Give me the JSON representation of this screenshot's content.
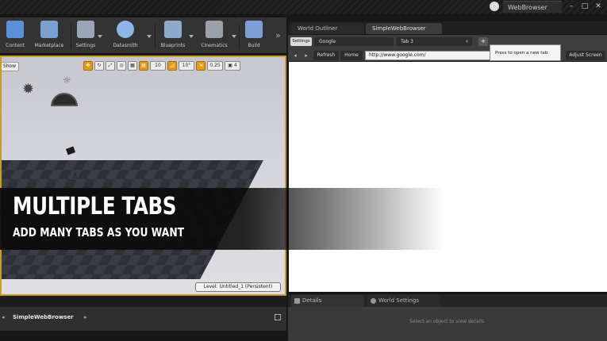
{
  "titlebar": {
    "app_title": "WebBrowser",
    "minimize": "–",
    "maximize": "□",
    "close": "✕"
  },
  "toolbar": {
    "buttons": [
      {
        "label": "Content",
        "icon": "grid-icon",
        "color": "#5b8fd8"
      },
      {
        "label": "Marketplace",
        "icon": "marketplace-icon",
        "color": "#7aa0cf"
      },
      {
        "label": "Settings",
        "icon": "gear-icon",
        "color": "#9aa6b8"
      },
      {
        "label": "Datasmith",
        "icon": "datasmith-icon",
        "color": "#8fb6e8"
      },
      {
        "label": "Blueprints",
        "icon": "blueprint-icon",
        "color": "#8fa9c8"
      },
      {
        "label": "Cinematics",
        "icon": "clapper-icon",
        "color": "#9aa0aa"
      },
      {
        "label": "Build",
        "icon": "build-icon",
        "color": "#7d9fd6"
      }
    ],
    "more": "»"
  },
  "viewport": {
    "show_label": "Show",
    "tools": [
      "✥",
      "↻",
      "⤢",
      "◎",
      "▦",
      "▤",
      "10",
      "◿",
      "10°",
      "⇲",
      "0.25",
      "▣ 4"
    ],
    "level_label": "Level: Untitled_1 (Persistent)"
  },
  "right_tabs": {
    "world_outliner": "World Outliner",
    "simple_web_browser": "SimpleWebBrowser"
  },
  "browser": {
    "settings_label": "Settings",
    "tabs": [
      {
        "label": "Google"
      },
      {
        "label": "Tab 3"
      }
    ],
    "tab_close": "×",
    "new_tab": "+",
    "tooltip": "Press to open a new tab",
    "back": "◂",
    "forward": "▸",
    "refresh_label": "Refresh",
    "home_label": "Home",
    "url": "http://www.google.com/",
    "adjust_label": "Adjust Screen"
  },
  "details": {
    "details_tab": "Details",
    "world_settings_tab": "World Settings",
    "hint": "Select an object to view details."
  },
  "content_browser": {
    "path_item": "SimpleWebBrowser",
    "left_arrow": "◂",
    "right_arrow": "▸"
  },
  "banner": {
    "title": "MULTIPLE TABS",
    "subtitle": "ADD MANY TABS AS YOU WANT"
  }
}
